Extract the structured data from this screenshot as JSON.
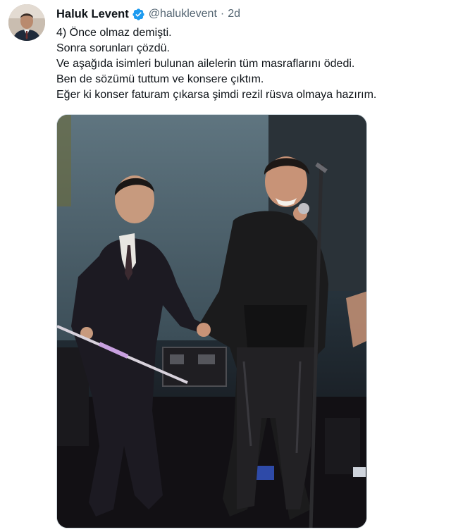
{
  "tweet": {
    "author_name": "Haluk Levent",
    "verified_icon": "verified-badge-icon",
    "handle": "@haluklevent",
    "separator": "·",
    "time": "2d",
    "lines": [
      "4) Önce olmaz demişti.",
      "Sonra sorunları çözdü.",
      "Ve aşağıda isimleri bulunan ailelerin tüm masraflarını ödedi.",
      "Ben de sözümü tuttum ve konsere çıktım.",
      "Eğer ki konser faturam çıkarsa şimdi rezil rüsva olmaya hazırım."
    ],
    "media_alt": "photo"
  },
  "colors": {
    "text": "#0f1419",
    "secondary": "#536471",
    "verified": "#1d9bf0",
    "border": "#cfd9de"
  }
}
